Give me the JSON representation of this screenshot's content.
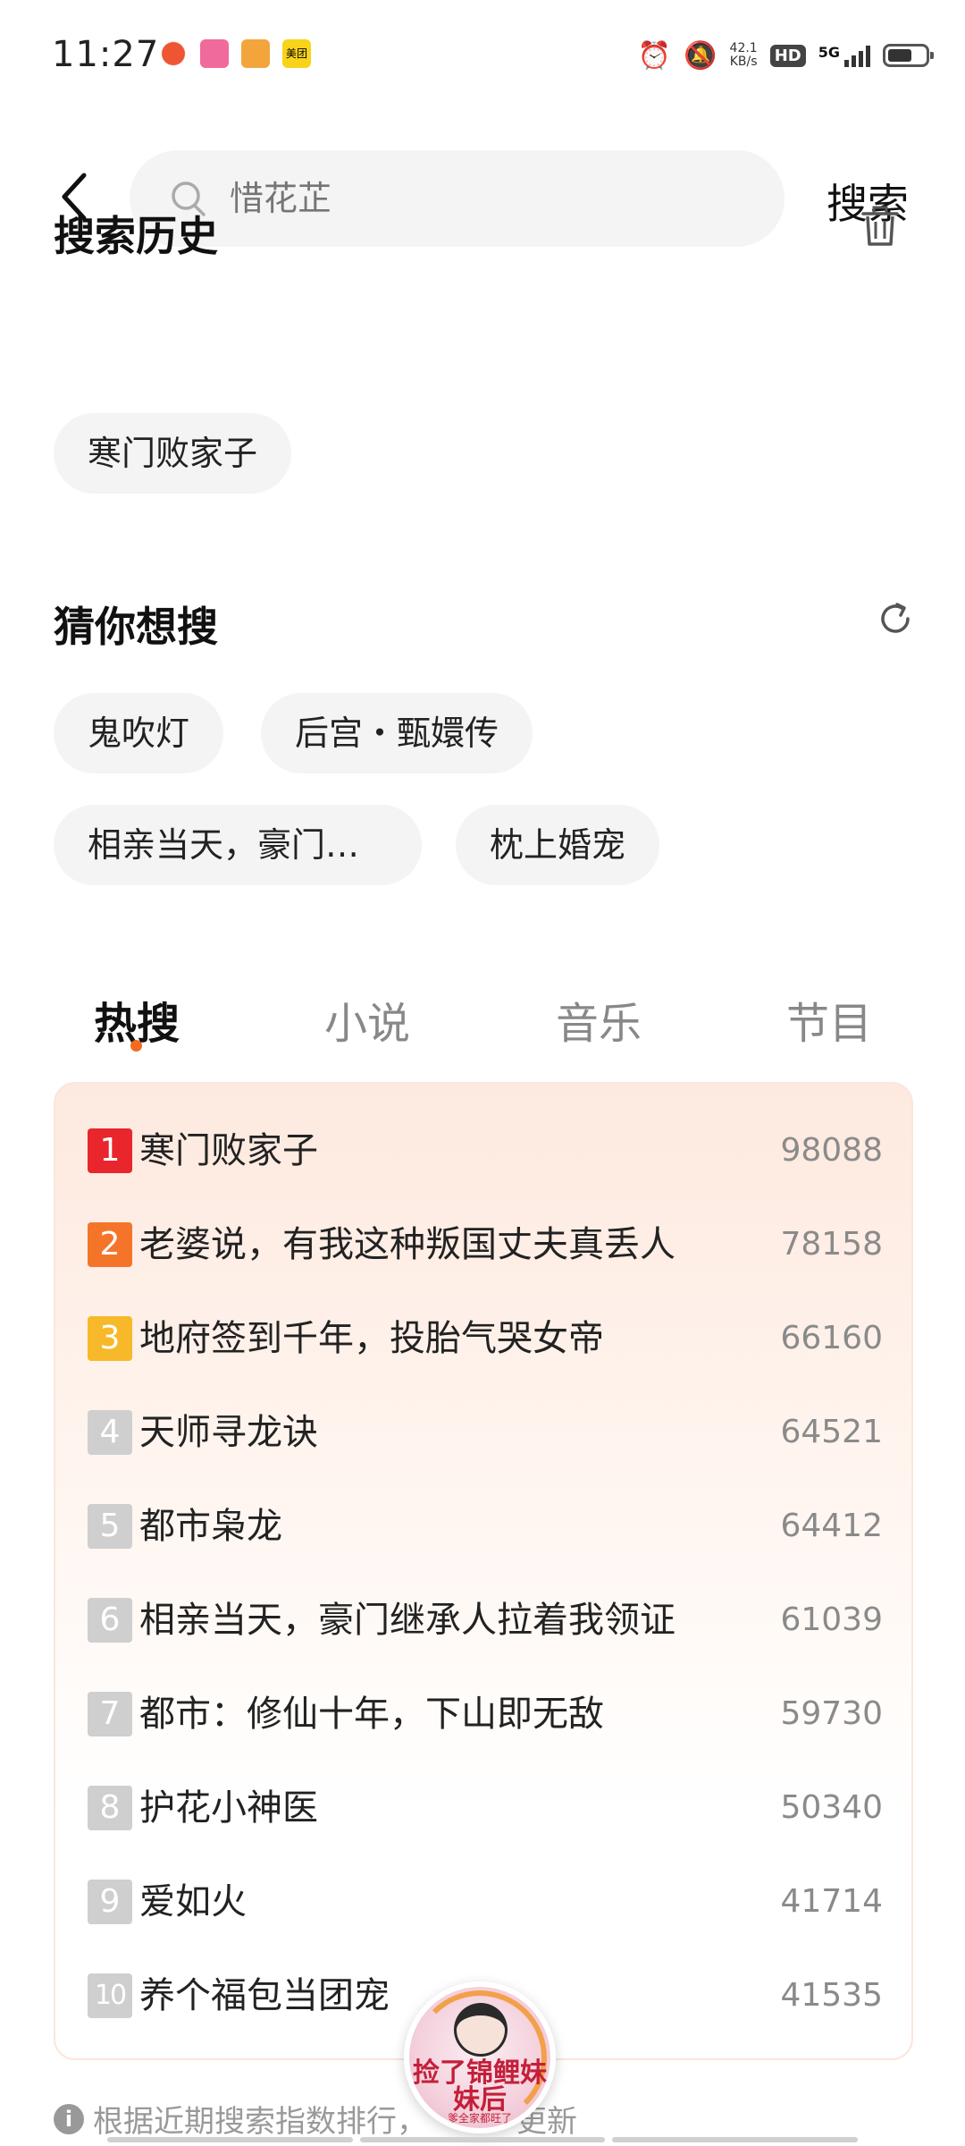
{
  "status_bar": {
    "time": "11:27",
    "net_speed_value": "42.1",
    "net_speed_unit": "KB/s",
    "hd_label": "HD",
    "signal_label": "5G",
    "notif_meituan": "美团"
  },
  "search": {
    "placeholder": "惜花芷",
    "button_label": "搜索"
  },
  "history": {
    "title": "搜索历史",
    "items": [
      "寒门败家子"
    ]
  },
  "guess": {
    "title": "猜你想搜",
    "items": [
      "鬼吹灯",
      "后宫・甄嬛传",
      "相亲当天，豪门…",
      "枕上婚宠"
    ]
  },
  "tabs": [
    {
      "label": "热搜",
      "active": true
    },
    {
      "label": "小说",
      "active": false
    },
    {
      "label": "音乐",
      "active": false
    },
    {
      "label": "节目",
      "active": false
    }
  ],
  "ranking": [
    {
      "rank": "1",
      "title": "寒门败家子",
      "count": "98088"
    },
    {
      "rank": "2",
      "title": "老婆说，有我这种叛国丈夫真丢人",
      "count": "78158"
    },
    {
      "rank": "3",
      "title": "地府签到千年，投胎气哭女帝",
      "count": "66160"
    },
    {
      "rank": "4",
      "title": "天师寻龙诀",
      "count": "64521"
    },
    {
      "rank": "5",
      "title": "都市枭龙",
      "count": "64412"
    },
    {
      "rank": "6",
      "title": "相亲当天，豪门继承人拉着我领证",
      "count": "61039"
    },
    {
      "rank": "7",
      "title": "都市：修仙十年，下山即无敌",
      "count": "59730"
    },
    {
      "rank": "8",
      "title": "护花小神医",
      "count": "50340"
    },
    {
      "rank": "9",
      "title": "爱如火",
      "count": "41714"
    },
    {
      "rank": "10",
      "title": "养个福包当团宠",
      "count": "41535"
    }
  ],
  "footer_note": "根据近期搜索指数排行，",
  "footer_note_tail": "更新",
  "floating_cover": {
    "title": "捡了锦鲤妹妹后",
    "subtitle": "爹全家都旺了"
  },
  "colors": {
    "accent": "#f26b21",
    "rank1": "#e8262b",
    "rank2": "#f4752a",
    "rank3": "#f7b92a",
    "rank_default": "#cfcfcf"
  }
}
